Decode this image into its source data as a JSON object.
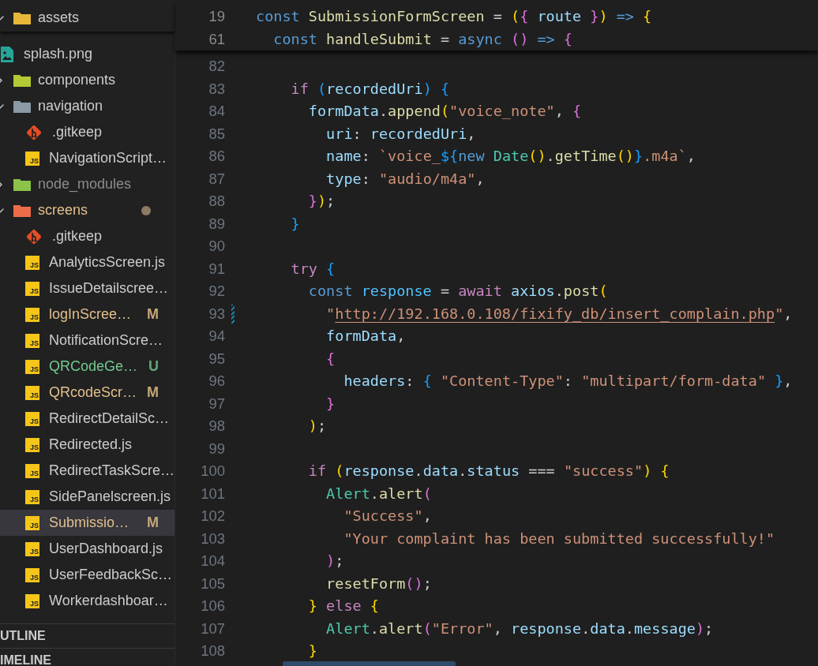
{
  "explorer": {
    "sticky_folder": {
      "name": "assets",
      "color": "#e8b73a",
      "expanded": true
    },
    "items": [
      {
        "kind": "image",
        "name": "splash.png",
        "modified": false,
        "untracked": false,
        "ignored": false,
        "selected": false
      },
      {
        "kind": "folder",
        "name": "components",
        "color": "#b5c934",
        "expanded": false,
        "modified": false,
        "untracked": false,
        "ignored": false,
        "selected": false
      },
      {
        "kind": "folder",
        "name": "navigation",
        "color": "#8a9aa6",
        "expanded": true,
        "modified": false,
        "untracked": false,
        "ignored": false,
        "selected": false,
        "children": [
          {
            "kind": "git",
            "name": ".gitkeep",
            "modified": false,
            "untracked": false,
            "ignored": false,
            "selected": false
          },
          {
            "kind": "js",
            "icon_label": "JS",
            "name": "NavigationScript…",
            "modified": false,
            "untracked": false,
            "ignored": false,
            "selected": false
          }
        ]
      },
      {
        "kind": "folder",
        "name": "node_modules",
        "color": "#8bc34a",
        "expanded": false,
        "modified": false,
        "untracked": false,
        "ignored": true,
        "selected": false
      },
      {
        "kind": "folder",
        "name": "screens",
        "color": "#ef6c4a",
        "expanded": true,
        "modified": true,
        "untracked": false,
        "ignored": false,
        "dot": true,
        "selected": false,
        "children": [
          {
            "kind": "git",
            "name": ".gitkeep",
            "modified": false,
            "untracked": false,
            "ignored": false,
            "selected": false
          },
          {
            "kind": "js",
            "icon_label": "JS",
            "name": "AnalyticsScreen.js",
            "modified": false,
            "untracked": false,
            "ignored": false,
            "selected": false
          },
          {
            "kind": "js",
            "icon_label": "JS",
            "name": "IssueDetailscree…",
            "modified": false,
            "untracked": false,
            "ignored": false,
            "selected": false
          },
          {
            "kind": "js",
            "icon_label": "JS",
            "name": "logInScree…",
            "modified": true,
            "untracked": false,
            "ignored": false,
            "badge": "M",
            "selected": false
          },
          {
            "kind": "js",
            "icon_label": "JS",
            "name": "NotificationScre…",
            "modified": false,
            "untracked": false,
            "ignored": false,
            "selected": false
          },
          {
            "kind": "js",
            "icon_label": "JS",
            "name": "QRCodeGe…",
            "modified": false,
            "untracked": true,
            "ignored": false,
            "badge": "U",
            "selected": false
          },
          {
            "kind": "js",
            "icon_label": "JS",
            "name": "QRcodeScr…",
            "modified": true,
            "untracked": false,
            "ignored": false,
            "badge": "M",
            "selected": false
          },
          {
            "kind": "js",
            "icon_label": "JS",
            "name": "RedirectDetailSc…",
            "modified": false,
            "untracked": false,
            "ignored": false,
            "selected": false
          },
          {
            "kind": "js",
            "icon_label": "JS",
            "name": "Redirected.js",
            "modified": false,
            "untracked": false,
            "ignored": false,
            "selected": false
          },
          {
            "kind": "js",
            "icon_label": "JS",
            "name": "RedirectTaskScre…",
            "modified": false,
            "untracked": false,
            "ignored": false,
            "selected": false
          },
          {
            "kind": "js",
            "icon_label": "JS",
            "name": "SidePanelscreen.js",
            "modified": false,
            "untracked": false,
            "ignored": false,
            "selected": false
          },
          {
            "kind": "js",
            "icon_label": "JS",
            "name": "Submissio…",
            "modified": true,
            "untracked": false,
            "ignored": false,
            "badge": "M",
            "selected": true
          },
          {
            "kind": "js",
            "icon_label": "JS",
            "name": "UserDashboard.js",
            "modified": false,
            "untracked": false,
            "ignored": false,
            "selected": false
          },
          {
            "kind": "js",
            "icon_label": "JS",
            "name": "UserFeedbackSc…",
            "modified": false,
            "untracked": false,
            "ignored": false,
            "selected": false
          },
          {
            "kind": "js",
            "icon_label": "JS",
            "name": "Workerdashboar…",
            "modified": false,
            "untracked": false,
            "ignored": false,
            "selected": false
          }
        ]
      }
    ],
    "panels": [
      "UTLINE",
      "IMELINE"
    ]
  },
  "editor": {
    "sticky_lines": [
      {
        "number": "19",
        "tokens": [
          {
            "kind": "kw",
            "text": "const "
          },
          {
            "kind": "fn",
            "text": "SubmissionFormScreen"
          },
          {
            "kind": "p",
            "text": " = "
          },
          {
            "kind": "b1",
            "text": "("
          },
          {
            "kind": "b2",
            "text": "{"
          },
          {
            "kind": "var",
            "text": " route "
          },
          {
            "kind": "b2",
            "text": "}"
          },
          {
            "kind": "b1",
            "text": ")"
          },
          {
            "kind": "kw",
            "text": " => "
          },
          {
            "kind": "b1",
            "text": "{"
          }
        ]
      },
      {
        "number": "61",
        "tokens": [
          {
            "kind": "kw",
            "text": "  const "
          },
          {
            "kind": "fn",
            "text": "handleSubmit"
          },
          {
            "kind": "p",
            "text": " = "
          },
          {
            "kind": "kw",
            "text": "async "
          },
          {
            "kind": "b2",
            "text": "()"
          },
          {
            "kind": "kw",
            "text": " => "
          },
          {
            "kind": "b2",
            "text": "{"
          }
        ]
      }
    ],
    "lines": [
      {
        "number": "82"
      },
      {
        "number": "83",
        "tokens": [
          {
            "kind": "ctl",
            "text": "    if "
          },
          {
            "kind": "b3",
            "text": "("
          },
          {
            "kind": "var",
            "text": "recordedUri"
          },
          {
            "kind": "b3",
            "text": ") {"
          }
        ]
      },
      {
        "number": "84",
        "tokens": [
          {
            "kind": "var",
            "text": "      formData"
          },
          {
            "kind": "p",
            "text": "."
          },
          {
            "kind": "fn",
            "text": "append"
          },
          {
            "kind": "b1",
            "text": "("
          },
          {
            "kind": "str",
            "text": "\"voice_note\""
          },
          {
            "kind": "p",
            "text": ", "
          },
          {
            "kind": "b2",
            "text": "{"
          }
        ]
      },
      {
        "number": "85",
        "tokens": [
          {
            "kind": "var",
            "text": "        uri"
          },
          {
            "kind": "p",
            "text": ": "
          },
          {
            "kind": "var",
            "text": "recordedUri"
          },
          {
            "kind": "p",
            "text": ","
          }
        ]
      },
      {
        "number": "86",
        "tokens": [
          {
            "kind": "var",
            "text": "        name"
          },
          {
            "kind": "p",
            "text": ": "
          },
          {
            "kind": "str",
            "text": "`voice_"
          },
          {
            "kind": "b3",
            "text": "${"
          },
          {
            "kind": "kw",
            "text": "new "
          },
          {
            "kind": "cls",
            "text": "Date"
          },
          {
            "kind": "b1",
            "text": "()"
          },
          {
            "kind": "p",
            "text": "."
          },
          {
            "kind": "fn",
            "text": "getTime"
          },
          {
            "kind": "b1",
            "text": "()"
          },
          {
            "kind": "b3",
            "text": "}"
          },
          {
            "kind": "str",
            "text": ".m4a`"
          },
          {
            "kind": "p",
            "text": ","
          }
        ]
      },
      {
        "number": "87",
        "tokens": [
          {
            "kind": "var",
            "text": "        type"
          },
          {
            "kind": "p",
            "text": ": "
          },
          {
            "kind": "str",
            "text": "\"audio/m4a\""
          },
          {
            "kind": "p",
            "text": ","
          }
        ]
      },
      {
        "number": "88",
        "tokens": [
          {
            "kind": "b2",
            "text": "      }"
          },
          {
            "kind": "b1",
            "text": ")"
          },
          {
            "kind": "p",
            "text": ";"
          }
        ]
      },
      {
        "number": "89",
        "tokens": [
          {
            "kind": "b3",
            "text": "    }"
          }
        ]
      },
      {
        "number": "90"
      },
      {
        "number": "91",
        "tokens": [
          {
            "kind": "ctl",
            "text": "    try "
          },
          {
            "kind": "b3",
            "text": "{"
          }
        ]
      },
      {
        "number": "92",
        "tokens": [
          {
            "kind": "kw",
            "text": "      const "
          },
          {
            "kind": "cvar",
            "text": "response"
          },
          {
            "kind": "p",
            "text": " = "
          },
          {
            "kind": "ctl",
            "text": "await "
          },
          {
            "kind": "var",
            "text": "axios"
          },
          {
            "kind": "p",
            "text": "."
          },
          {
            "kind": "fn",
            "text": "post"
          },
          {
            "kind": "b1",
            "text": "("
          }
        ]
      },
      {
        "number": "93",
        "modified": true,
        "tokens": [
          {
            "kind": "str",
            "text": "        \""
          },
          {
            "kind": "link",
            "text": "http://192.168.0.108/fixify_db/insert_complain.php"
          },
          {
            "kind": "str",
            "text": "\""
          },
          {
            "kind": "p",
            "text": ","
          }
        ]
      },
      {
        "number": "94",
        "tokens": [
          {
            "kind": "var",
            "text": "        formData"
          },
          {
            "kind": "p",
            "text": ","
          }
        ]
      },
      {
        "number": "95",
        "tokens": [
          {
            "kind": "b2",
            "text": "        {"
          }
        ]
      },
      {
        "number": "96",
        "tokens": [
          {
            "kind": "var",
            "text": "          headers"
          },
          {
            "kind": "p",
            "text": ": "
          },
          {
            "kind": "b3",
            "text": "{ "
          },
          {
            "kind": "str",
            "text": "\"Content-Type\""
          },
          {
            "kind": "p",
            "text": ": "
          },
          {
            "kind": "str",
            "text": "\"multipart/form-data\""
          },
          {
            "kind": "b3",
            "text": " }"
          },
          {
            "kind": "p",
            "text": ","
          }
        ]
      },
      {
        "number": "97",
        "tokens": [
          {
            "kind": "b2",
            "text": "        }"
          }
        ]
      },
      {
        "number": "98",
        "tokens": [
          {
            "kind": "b1",
            "text": "      )"
          },
          {
            "kind": "p",
            "text": ";"
          }
        ]
      },
      {
        "number": "99"
      },
      {
        "number": "100",
        "tokens": [
          {
            "kind": "ctl",
            "text": "      if "
          },
          {
            "kind": "b1",
            "text": "("
          },
          {
            "kind": "var",
            "text": "response"
          },
          {
            "kind": "p",
            "text": "."
          },
          {
            "kind": "var",
            "text": "data"
          },
          {
            "kind": "p",
            "text": "."
          },
          {
            "kind": "var",
            "text": "status"
          },
          {
            "kind": "p",
            "text": " === "
          },
          {
            "kind": "str",
            "text": "\"success\""
          },
          {
            "kind": "b1",
            "text": ") {"
          }
        ]
      },
      {
        "number": "101",
        "tokens": [
          {
            "kind": "cls",
            "text": "        Alert"
          },
          {
            "kind": "p",
            "text": "."
          },
          {
            "kind": "fn",
            "text": "alert"
          },
          {
            "kind": "b2",
            "text": "("
          }
        ]
      },
      {
        "number": "102",
        "tokens": [
          {
            "kind": "str",
            "text": "          \"Success\""
          },
          {
            "kind": "p",
            "text": ","
          }
        ]
      },
      {
        "number": "103",
        "tokens": [
          {
            "kind": "str",
            "text": "          \"Your complaint has been submitted successfully!\""
          }
        ]
      },
      {
        "number": "104",
        "tokens": [
          {
            "kind": "b2",
            "text": "        )"
          },
          {
            "kind": "p",
            "text": ";"
          }
        ]
      },
      {
        "number": "105",
        "tokens": [
          {
            "kind": "fn",
            "text": "        resetForm"
          },
          {
            "kind": "b2",
            "text": "()"
          },
          {
            "kind": "p",
            "text": ";"
          }
        ]
      },
      {
        "number": "106",
        "tokens": [
          {
            "kind": "b1",
            "text": "      }"
          },
          {
            "kind": "ctl",
            "text": " else "
          },
          {
            "kind": "b1",
            "text": "{"
          }
        ]
      },
      {
        "number": "107",
        "tokens": [
          {
            "kind": "cls",
            "text": "        Alert"
          },
          {
            "kind": "p",
            "text": "."
          },
          {
            "kind": "fn",
            "text": "alert"
          },
          {
            "kind": "b2",
            "text": "("
          },
          {
            "kind": "str",
            "text": "\"Error\""
          },
          {
            "kind": "p",
            "text": ", "
          },
          {
            "kind": "var",
            "text": "response"
          },
          {
            "kind": "p",
            "text": "."
          },
          {
            "kind": "var",
            "text": "data"
          },
          {
            "kind": "p",
            "text": "."
          },
          {
            "kind": "var",
            "text": "message"
          },
          {
            "kind": "b2",
            "text": ")"
          },
          {
            "kind": "p",
            "text": ";"
          }
        ]
      },
      {
        "number": "108",
        "tokens": [
          {
            "kind": "b1",
            "text": "      }"
          }
        ]
      }
    ]
  }
}
